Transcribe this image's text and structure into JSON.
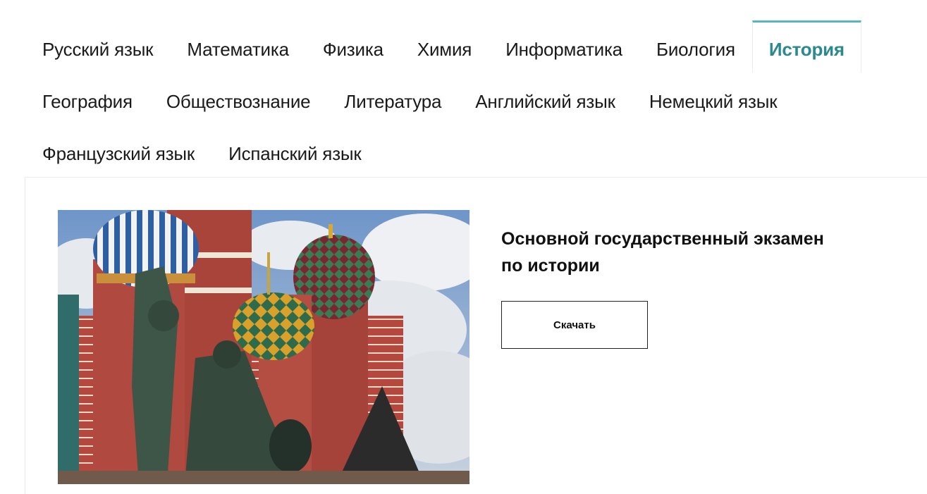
{
  "tabs": [
    {
      "label": "Русский язык",
      "active": false
    },
    {
      "label": "Математика",
      "active": false
    },
    {
      "label": "Физика",
      "active": false
    },
    {
      "label": "Химия",
      "active": false
    },
    {
      "label": "Информатика",
      "active": false
    },
    {
      "label": "Биология",
      "active": false
    },
    {
      "label": "История",
      "active": true
    },
    {
      "label": "География",
      "active": false
    },
    {
      "label": "Обществознание",
      "active": false
    },
    {
      "label": "Литература",
      "active": false
    },
    {
      "label": "Английский язык",
      "active": false
    },
    {
      "label": "Немецкий язык",
      "active": false
    },
    {
      "label": "Французский язык",
      "active": false
    },
    {
      "label": "Испанский язык",
      "active": false
    }
  ],
  "content": {
    "title": "Основной государственный экзамен\nпо истории",
    "download_label": "Скачать"
  },
  "colors": {
    "accent": "#2a8a8f",
    "accent_border": "#5ab6bd",
    "text": "#1a1a1a"
  }
}
